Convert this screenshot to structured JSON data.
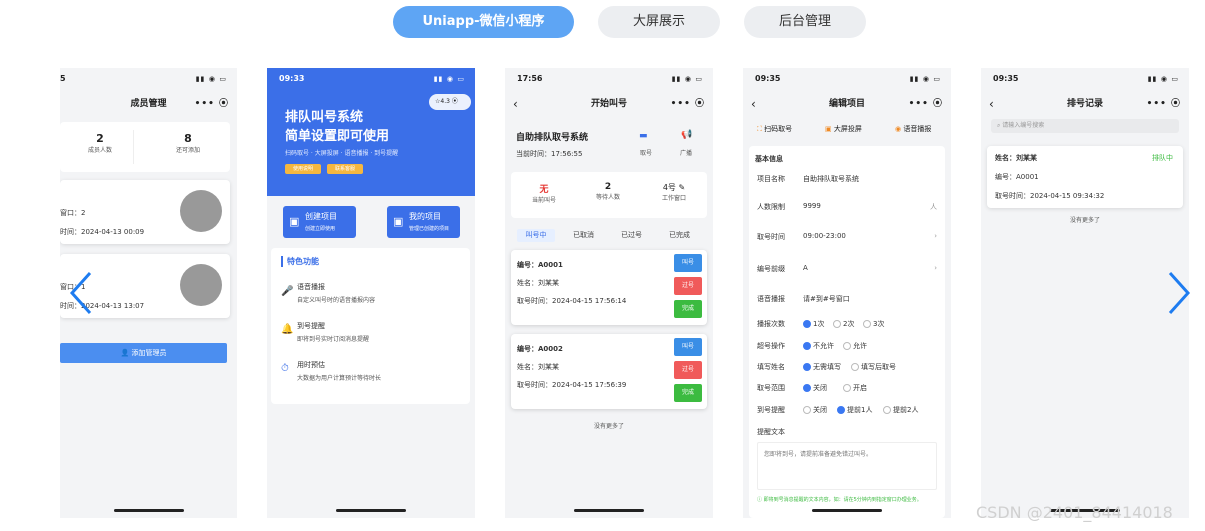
{
  "tabs": [
    {
      "label": "Uniapp-微信小程序"
    },
    {
      "label": "大屏展示"
    },
    {
      "label": "后台管理"
    }
  ],
  "phone1": {
    "time": "5",
    "title": "成员管理",
    "stats": [
      {
        "value": "2",
        "label": "成员人数"
      },
      {
        "value": "8",
        "label": "还可添加"
      }
    ],
    "members": [
      {
        "window": "窗口：2",
        "time": "时间：2024-04-13 00:09"
      },
      {
        "window": "窗口：1",
        "time": "时间：2024-04-13 13:07"
      }
    ],
    "add_button": "添加管理员"
  },
  "phone2": {
    "time": "09:33",
    "rating": "4.3",
    "hero_title1": "排队叫号系统",
    "hero_title2": "简单设置即可使用",
    "hero_sub": "扫码取号 · 大屏投屏 · 语音播报 · 到号提醒",
    "hero_tag1": "使用说明",
    "hero_tag2": "联系客服",
    "create_label": "创建项目",
    "create_sub": "创建立即使用",
    "mine_label": "我的项目",
    "mine_sub": "管理已创建的项目",
    "features_title": "特色功能",
    "features": [
      {
        "title": "语音播报",
        "desc": "自定义叫号时的语音播报内容"
      },
      {
        "title": "到号提醒",
        "desc": "即将到号实时订阅消息提醒"
      },
      {
        "title": "用时预估",
        "desc": "大数据为用户计算预计等待时长"
      }
    ]
  },
  "phone3": {
    "time": "17:56",
    "title": "开始叫号",
    "system_name": "自助排队取号系统",
    "current_time": "当前时间：17:56:55",
    "action1": "取号",
    "action2": "广播",
    "stats": [
      {
        "value": "无",
        "label": "当前叫号"
      },
      {
        "value": "2",
        "label": "等待人数"
      },
      {
        "value": "4号",
        "label": "工作窗口"
      }
    ],
    "subtabs": [
      "叫号中",
      "已取消",
      "已过号",
      "已完成"
    ],
    "tickets": [
      {
        "no": "编号：A0001",
        "name": "姓名：刘某某",
        "time": "取号时间：2024-04-15 17:56:14"
      },
      {
        "no": "编号：A0002",
        "name": "姓名：刘某某",
        "time": "取号时间：2024-04-15 17:56:39"
      }
    ],
    "btn_call": "叫号",
    "btn_pass": "过号",
    "btn_done": "完成",
    "no_more": "没有更多了"
  },
  "phone4": {
    "time": "09:35",
    "title": "编辑项目",
    "tools": [
      "扫码取号",
      "大屏投屏",
      "语音播报"
    ],
    "section": "基本信息",
    "fields": [
      {
        "label": "项目名称",
        "value": "自助排队取号系统"
      },
      {
        "label": "人数限制",
        "value": "9999",
        "unit": "人"
      },
      {
        "label": "取号时间",
        "value": "09:00-23:00"
      },
      {
        "label": "编号前缀",
        "value": "A"
      },
      {
        "label": "语音播报",
        "value": "请#到#号窗口"
      }
    ],
    "options": [
      {
        "label": "播报次数",
        "choices": [
          "1次",
          "2次",
          "3次"
        ]
      },
      {
        "label": "超号操作",
        "choices": [
          "不允许",
          "允许"
        ]
      },
      {
        "label": "填写姓名",
        "choices": [
          "无需填写",
          "填写后取号"
        ]
      },
      {
        "label": "取号范围",
        "choices": [
          "关闭",
          "开启"
        ]
      },
      {
        "label": "到号提醒",
        "choices": [
          "关闭",
          "提前1人",
          "提前2人"
        ]
      }
    ],
    "text_label": "提醒文本",
    "text_placeholder": "您即将到号，请提前准备避免错过叫号。",
    "hint": "即将到号消息提醒的文本内容，如：请在5分钟内到指定窗口办理业务。"
  },
  "phone5": {
    "time": "09:35",
    "title": "排号记录",
    "search_placeholder": "请输入编号搜索",
    "record": {
      "name": "姓名：刘某某",
      "status": "排队中",
      "no": "编号：A0001",
      "time": "取号时间：2024-04-15 09:34:32"
    },
    "no_more": "没有更多了"
  },
  "watermark": "CSDN @2401_84414018",
  "colors": {
    "accent": "#3a78f2",
    "tab_active": "#5ea5f4",
    "call": "#3a8ee6",
    "pass": "#f05a5a",
    "done": "#3cbb40",
    "status_green": "#3cbb40"
  }
}
